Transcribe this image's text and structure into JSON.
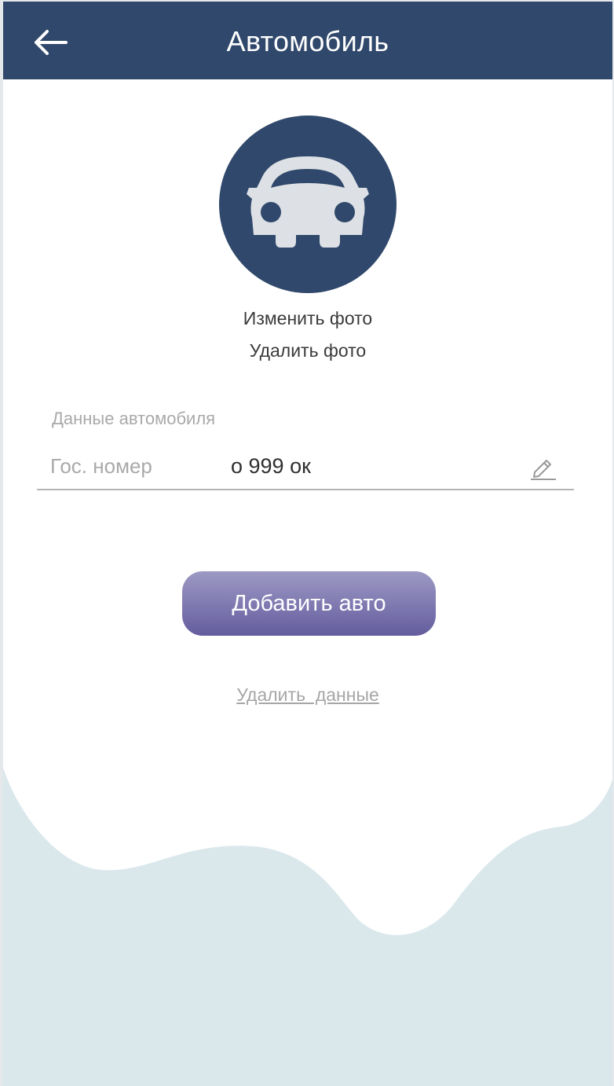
{
  "header": {
    "title": "Автомобиль",
    "back_icon": "arrow-left-icon"
  },
  "avatar": {
    "icon": "car-icon",
    "change_photo_label": "Изменить фото",
    "delete_photo_label": "Удалить фото"
  },
  "vehicle": {
    "section_label": "Данные автомобиля",
    "plate_label": "Гос. номер",
    "plate_value": "о 999 ок",
    "edit_icon": "pencil-icon"
  },
  "actions": {
    "add_button_label": "Добавить авто",
    "delete_data_label": "Удалить  данные"
  },
  "colors": {
    "header_bg": "#30486b",
    "accent_button": "#7e78b0",
    "wave_bg": "#dae8ec"
  }
}
